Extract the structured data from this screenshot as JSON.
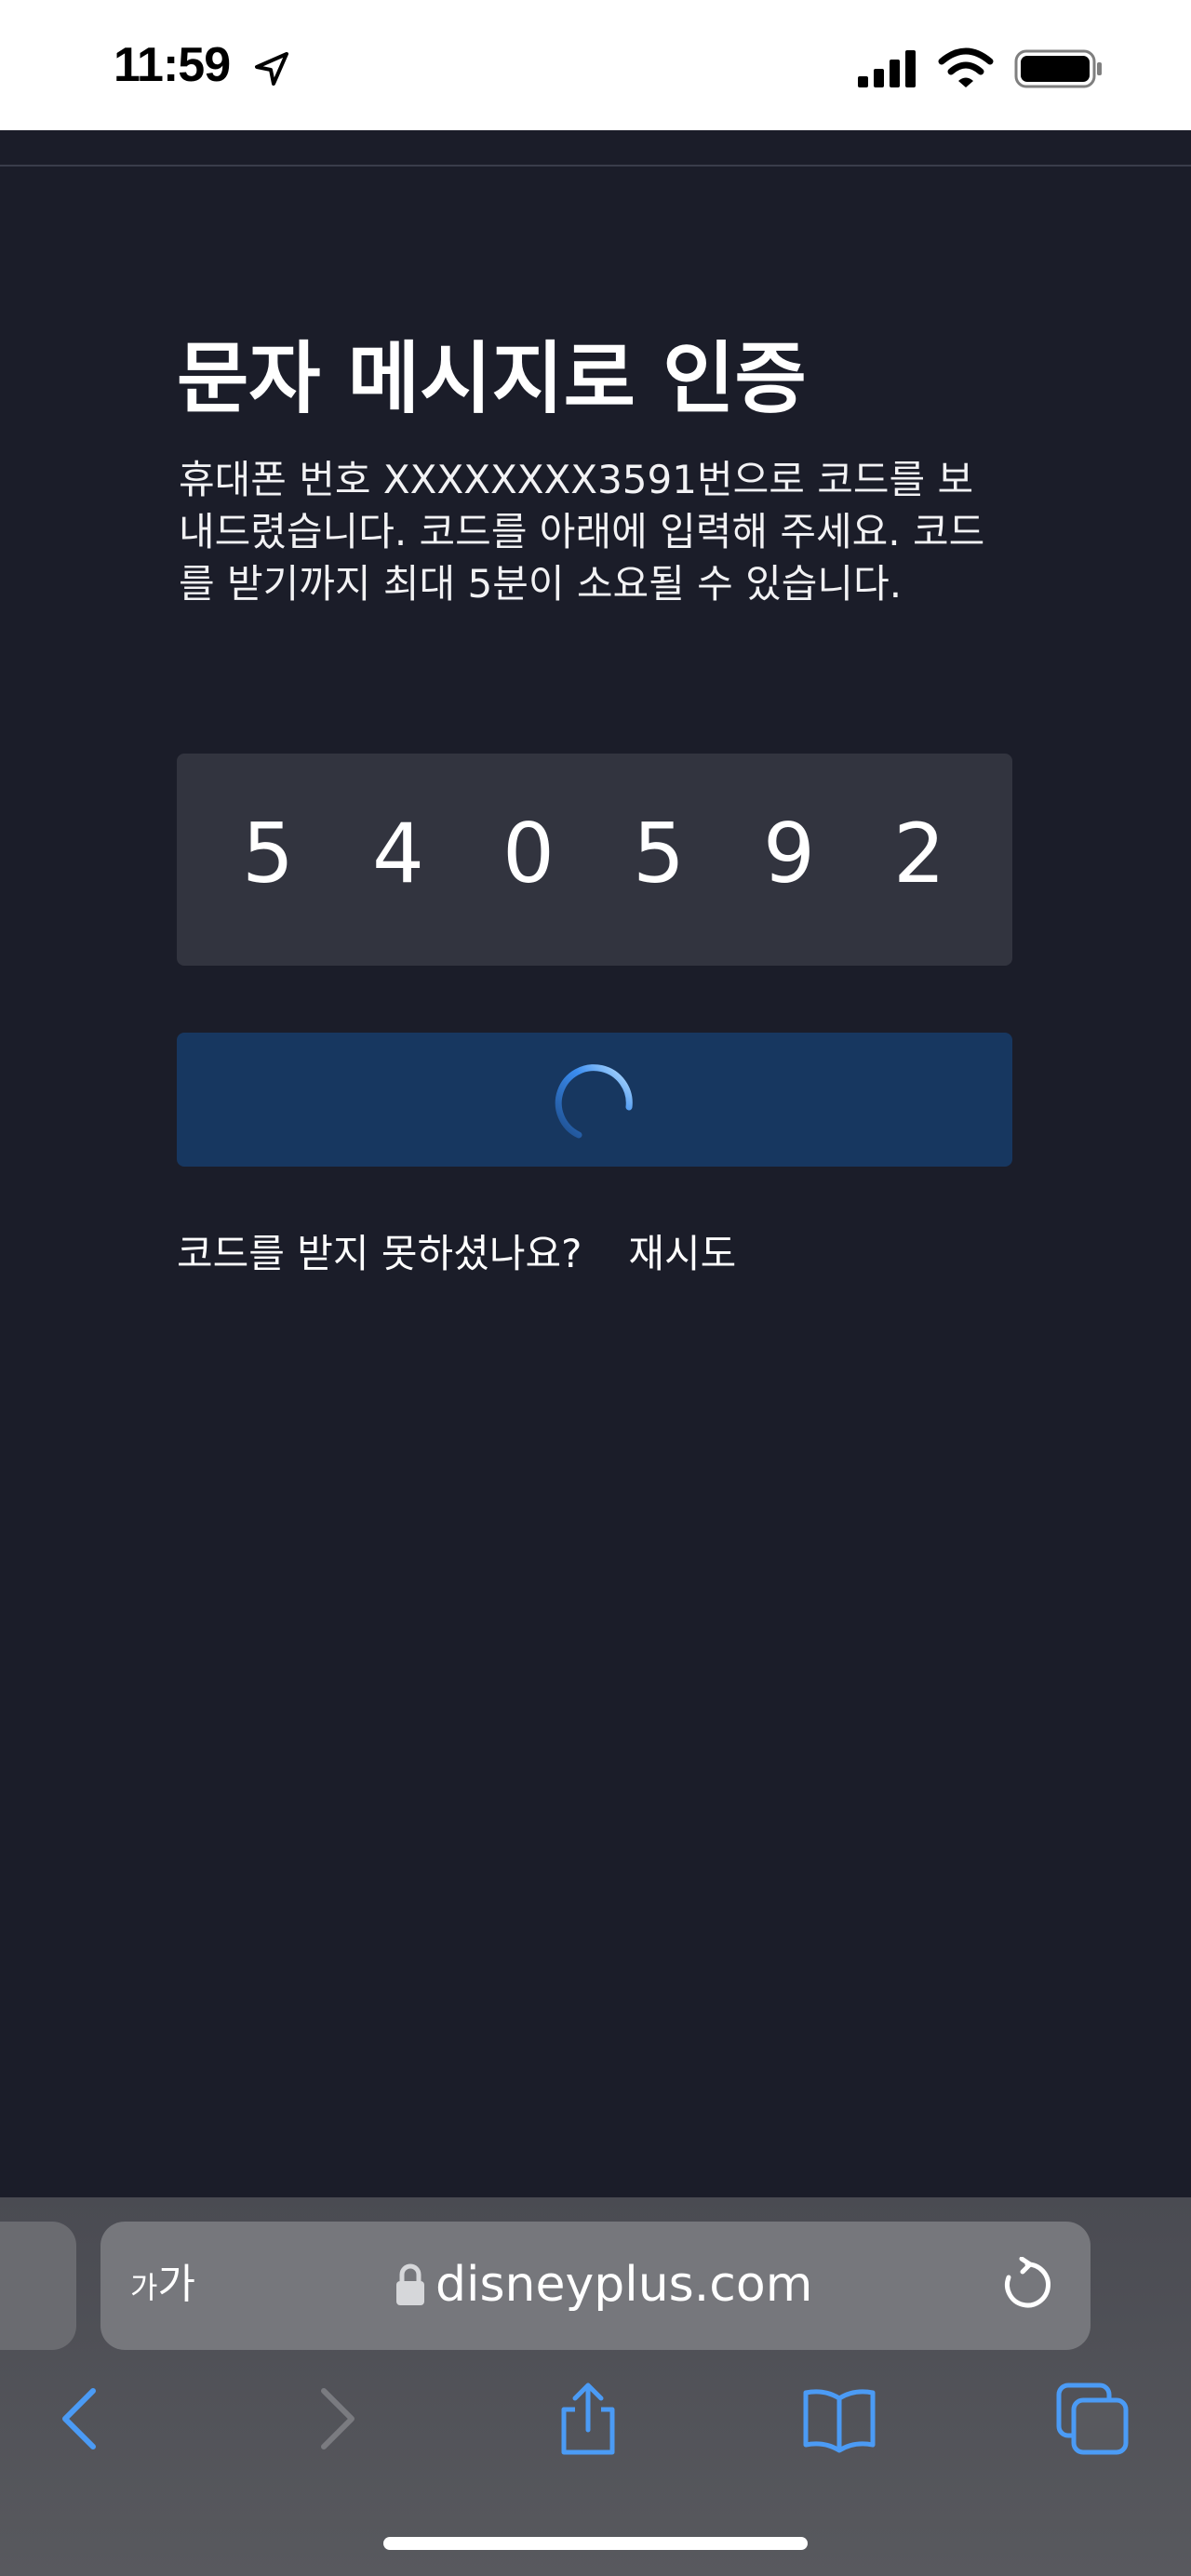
{
  "status_bar": {
    "time": "11:59",
    "icons": [
      "location-arrow-icon",
      "signal-icon",
      "wifi-icon",
      "battery-icon"
    ]
  },
  "main": {
    "title": "문자 메시지로 인증",
    "description": "휴대폰 번호 XXXXXXXX3591번으로 코드를 보내드렸습니다. 코드를 아래에 입력해 주세요. 코드를 받기까지 최대 5분이 소요될 수 있습니다.",
    "code_digits": [
      "5",
      "4",
      "0",
      "5",
      "9",
      "2"
    ],
    "submit_button": {
      "state": "loading",
      "icon": "spinner-icon",
      "color": "#173760"
    },
    "resend_prompt": "코드를 받지 못하셨나요?",
    "resend_link": "재시도"
  },
  "browser": {
    "text_size_small": "가",
    "text_size_large": "가",
    "url": "disneyplus.com",
    "icons": [
      "lock-icon",
      "reload-icon",
      "back-icon",
      "forward-icon",
      "share-icon",
      "bookmarks-icon",
      "tabs-icon"
    ]
  },
  "colors": {
    "background": "#1b1d29",
    "code_box": "#32343f",
    "accent": "#3b8df0"
  }
}
